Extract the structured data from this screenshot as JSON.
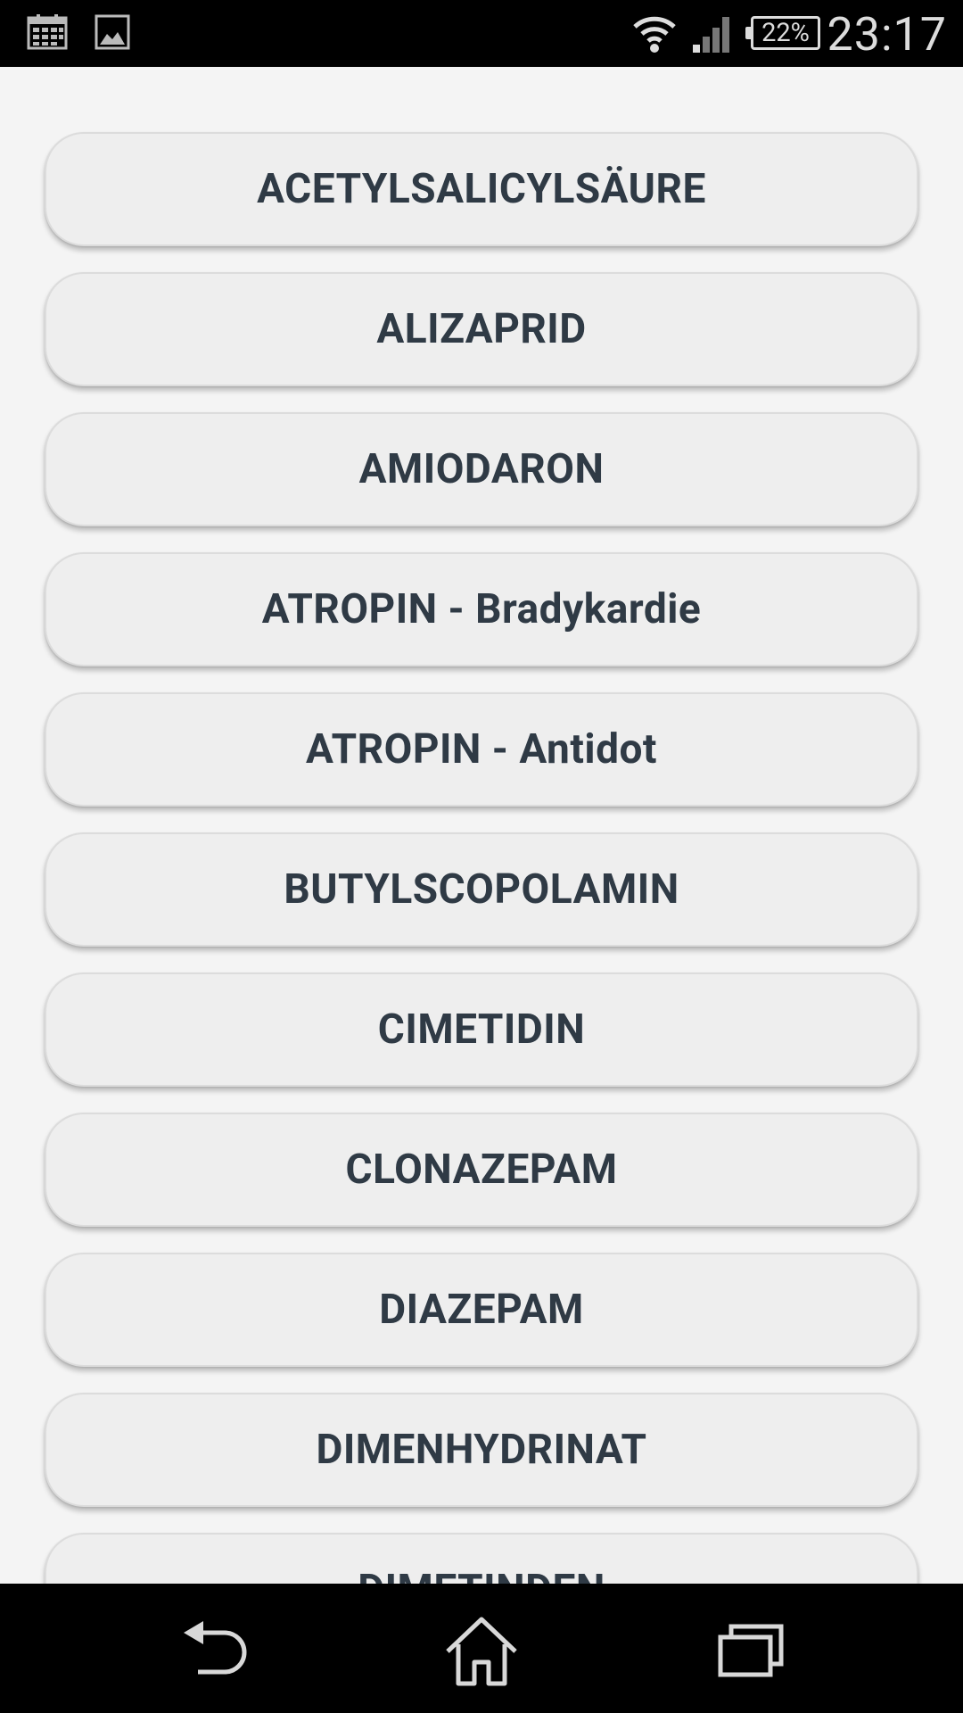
{
  "status_bar": {
    "time": "23:17",
    "battery_percent": "22%",
    "icons": [
      "calendar-icon",
      "image-icon",
      "wifi-icon",
      "signal-icon",
      "battery-icon"
    ]
  },
  "drugs": [
    "ACETYLSALICYLSÄURE",
    "ALIZAPRID",
    "AMIODARON",
    "ATROPIN - Bradykardie",
    "ATROPIN - Antidot",
    "BUTYLSCOPOLAMIN",
    "CIMETIDIN",
    "CLONAZEPAM",
    "DIAZEPAM",
    "DIMENHYDRINAT",
    "DIMETINDEN"
  ],
  "nav_bar": {
    "buttons": [
      "back-icon",
      "home-icon",
      "recent-apps-icon"
    ]
  },
  "colors": {
    "background": "#f4f4f4",
    "button_fill": "#eeeeee",
    "button_text": "#2f3a45",
    "bars": "#000000"
  }
}
